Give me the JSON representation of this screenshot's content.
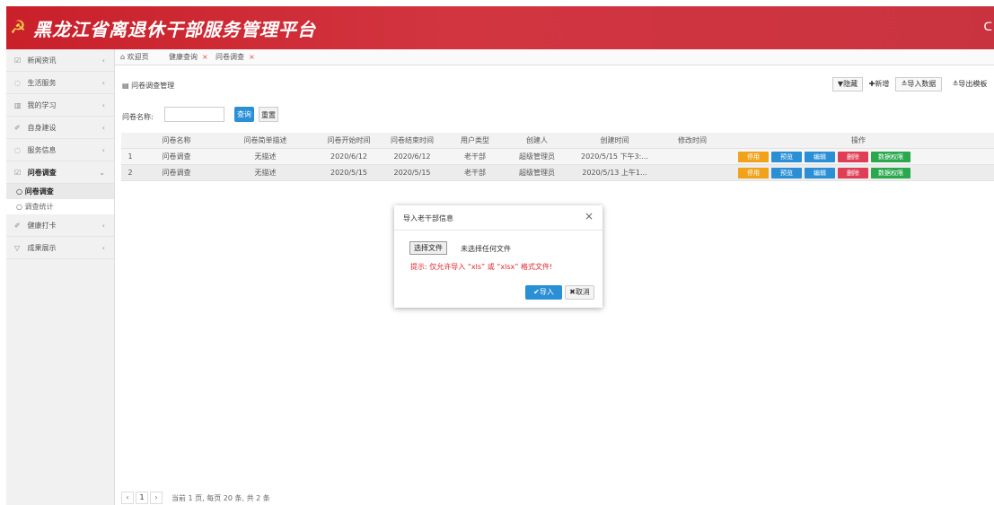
{
  "app": {
    "title": "黑龙江省离退休干部服务管理平台",
    "logo_icon": "party-emblem-icon",
    "header_right_icon": "power-icon",
    "brand_color": "#c9202a"
  },
  "sidebar": {
    "items": [
      {
        "label": "新闻资讯",
        "icon": "☑",
        "arrow": "‹"
      },
      {
        "label": "生活服务",
        "icon": "◌",
        "arrow": "‹"
      },
      {
        "label": "我的学习",
        "icon": "▥",
        "arrow": "‹"
      },
      {
        "label": "自身建设",
        "icon": "✐",
        "arrow": "‹"
      },
      {
        "label": "服务信息",
        "icon": "◌",
        "arrow": "‹"
      },
      {
        "label": "问卷调查",
        "icon": "☑",
        "arrow": "⌄"
      },
      {
        "label": "健康打卡",
        "icon": "✐",
        "arrow": "‹"
      },
      {
        "label": "成果展示",
        "icon": "▽",
        "arrow": "‹"
      }
    ],
    "sub_items": [
      {
        "label": "○ 问卷调查"
      },
      {
        "label": "○ 调查统计"
      }
    ]
  },
  "tabs": [
    {
      "label": "欢迎页",
      "icon": "⌂"
    },
    {
      "label": "健康查询",
      "close": "×"
    },
    {
      "label": "问卷调查",
      "close": "×"
    }
  ],
  "panel": {
    "title": "▤ 问卷调查管理"
  },
  "toolbar": {
    "hide": "▼隐藏",
    "add": "✚新增",
    "import": "≛导入数据",
    "export": "≛导出模板"
  },
  "search": {
    "label": "问卷名称:",
    "value": "",
    "query_button": "查询",
    "reset_button": "重置"
  },
  "table": {
    "columns": [
      "",
      "问卷名称",
      "问卷简单描述",
      "问卷开始时间",
      "问卷结束时间",
      "用户类型",
      "创建人",
      "创建时间",
      "修改时间",
      "操作"
    ],
    "rows": [
      {
        "no": "1",
        "name": "问卷调查",
        "desc": "无描述",
        "start": "2020/6/12",
        "end": "2020/6/12",
        "user_type": "老干部",
        "creator": "超级管理员",
        "created": "2020/5/15 下午3:...",
        "modified": ""
      },
      {
        "no": "2",
        "name": "问卷调查",
        "desc": "无描述",
        "start": "2020/5/15",
        "end": "2020/5/15",
        "user_type": "老干部",
        "creator": "超级管理员",
        "created": "2020/5/13 上午1...",
        "modified": ""
      }
    ],
    "actions": [
      {
        "label": "停用",
        "color": "#f0a21b"
      },
      {
        "label": "预览",
        "color": "#2b8fd6"
      },
      {
        "label": "编辑",
        "color": "#2b8fd6"
      },
      {
        "label": "删除",
        "color": "#e03e56"
      },
      {
        "label": "数据权限",
        "color": "#2aa84d"
      }
    ]
  },
  "pager": {
    "prev": "‹",
    "current": "1",
    "next": "›",
    "summary": "当前 1 页, 每页 20 条, 共 2 条"
  },
  "modal": {
    "title": "导入老干部信息",
    "close": "×",
    "file_button": "选择文件",
    "file_status": "未选择任何文件",
    "hint": "提示: 仅允许导入 “xls” 或 “xlsx” 格式文件!",
    "import_button": "✔导入",
    "cancel_button": "✖取消"
  }
}
